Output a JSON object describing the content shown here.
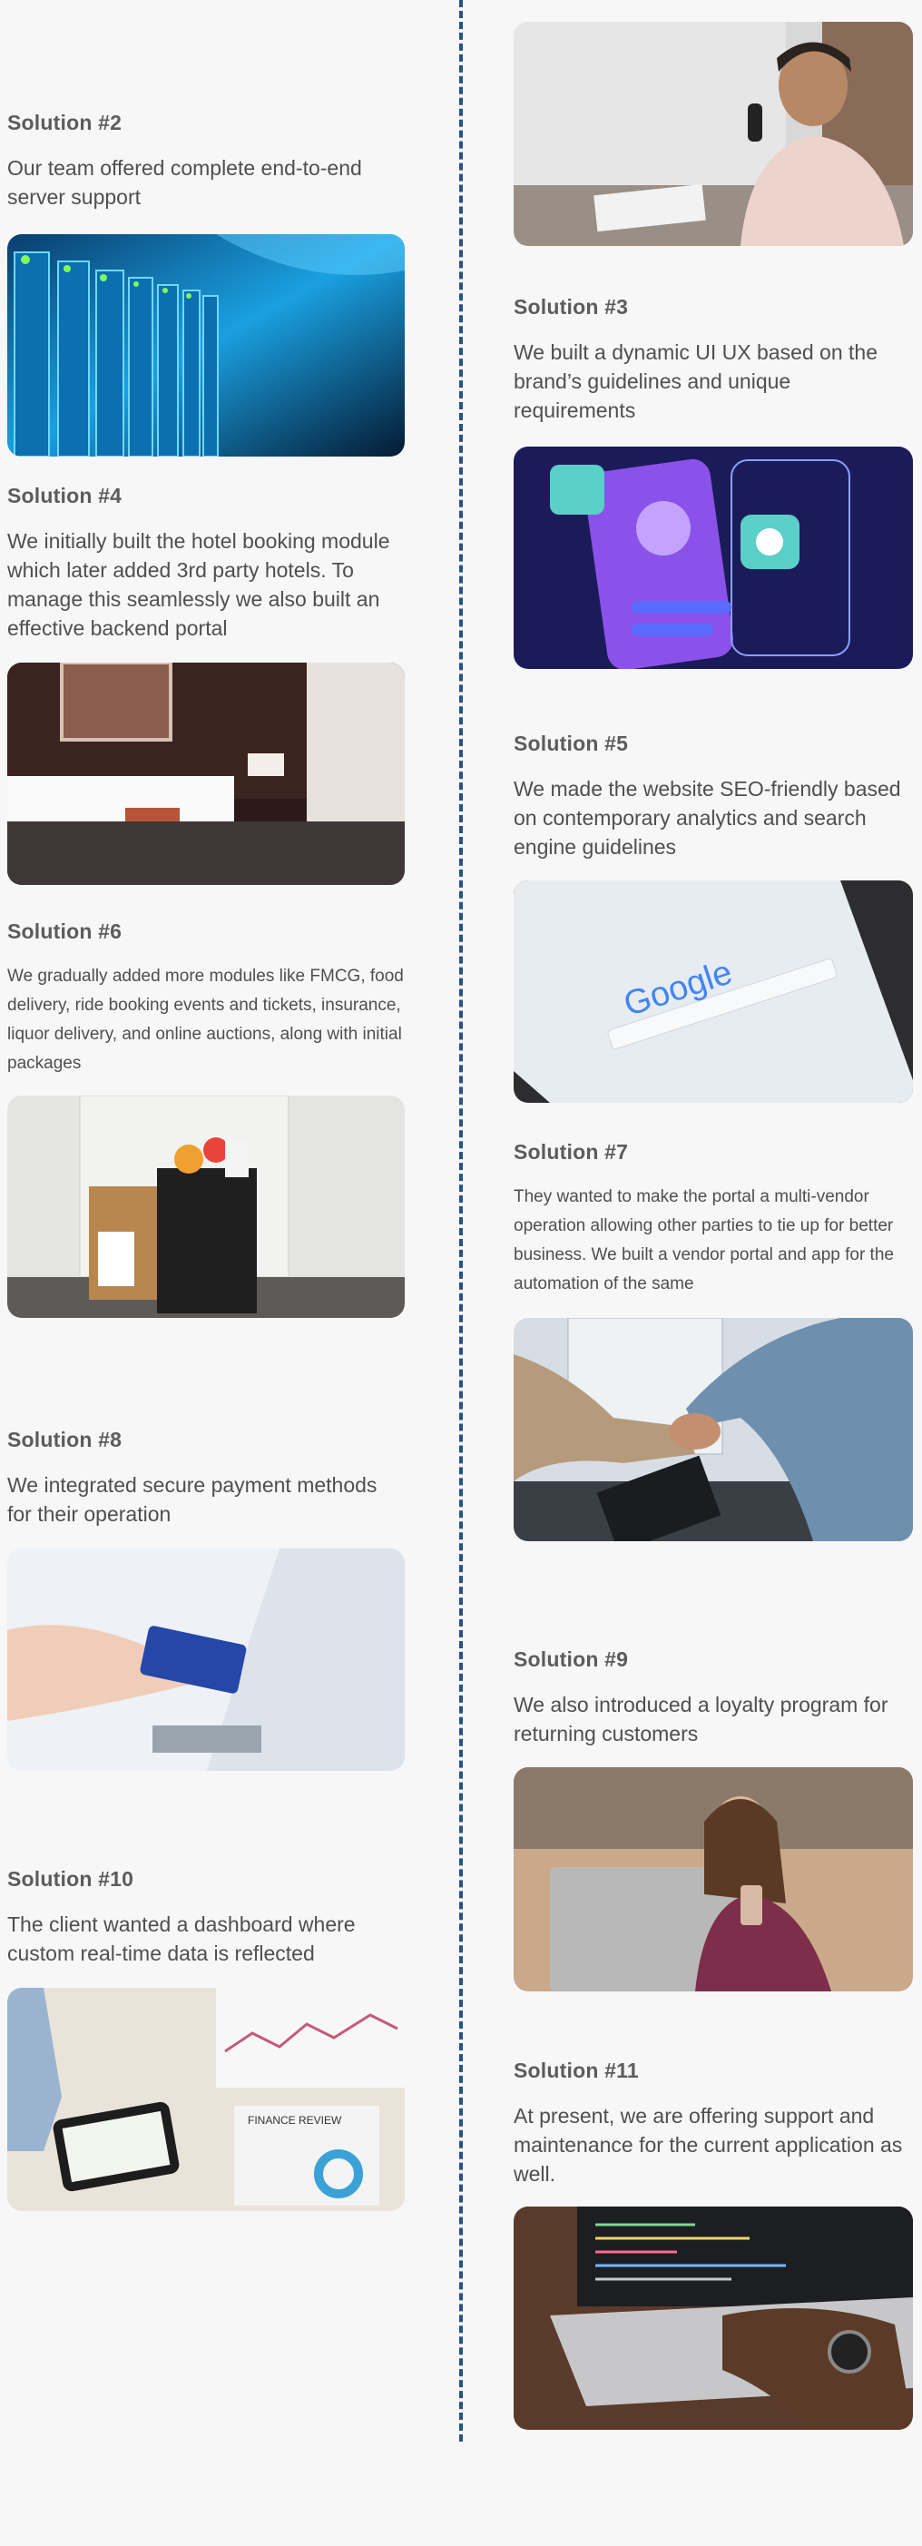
{
  "solutions": {
    "s2": {
      "title": "Solution #2",
      "desc": "Our team offered complete end-to-end server support"
    },
    "s3": {
      "title": "Solution #3",
      "desc": "We built a dynamic UI UX based on the brand’s guidelines and unique requirements"
    },
    "s4": {
      "title": "Solution #4",
      "desc": "We initially built the hotel booking module which later added 3rd party hotels. To manage this seamlessly we also built an effective backend portal"
    },
    "s5": {
      "title": "Solution #5",
      "desc": "We made the website SEO-friendly based on contemporary analytics and search engine guidelines"
    },
    "s6": {
      "title": "Solution #6",
      "desc": "We gradually added more modules like FMCG, food delivery, ride booking events and tickets, insurance, liquor delivery, and online auctions, along with initial packages"
    },
    "s7": {
      "title": "Solution #7",
      "desc": "They wanted to make the portal a multi-vendor operation allowing other parties to tie up for better business. We built a vendor portal and app for the automation of the same"
    },
    "s8": {
      "title": "Solution #8",
      "desc": "We integrated secure payment methods for their operation"
    },
    "s9": {
      "title": "Solution #9",
      "desc": "We also introduced a loyalty program for returning customers"
    },
    "s10": {
      "title": "Solution #10",
      "desc": "The client wanted a dashboard where custom real-time data is reflected"
    },
    "s11": {
      "title": "Solution #11",
      "desc": "At present, we are offering support and maintenance for the current application as well."
    }
  },
  "image_texts": {
    "google_logo": "Google",
    "finance_label": "FINANCE REVIEW"
  },
  "colors": {
    "divider": "#2b4f86",
    "background": "#f7f7f8",
    "title": "#5c5c5c",
    "text": "#4f4f4f"
  }
}
